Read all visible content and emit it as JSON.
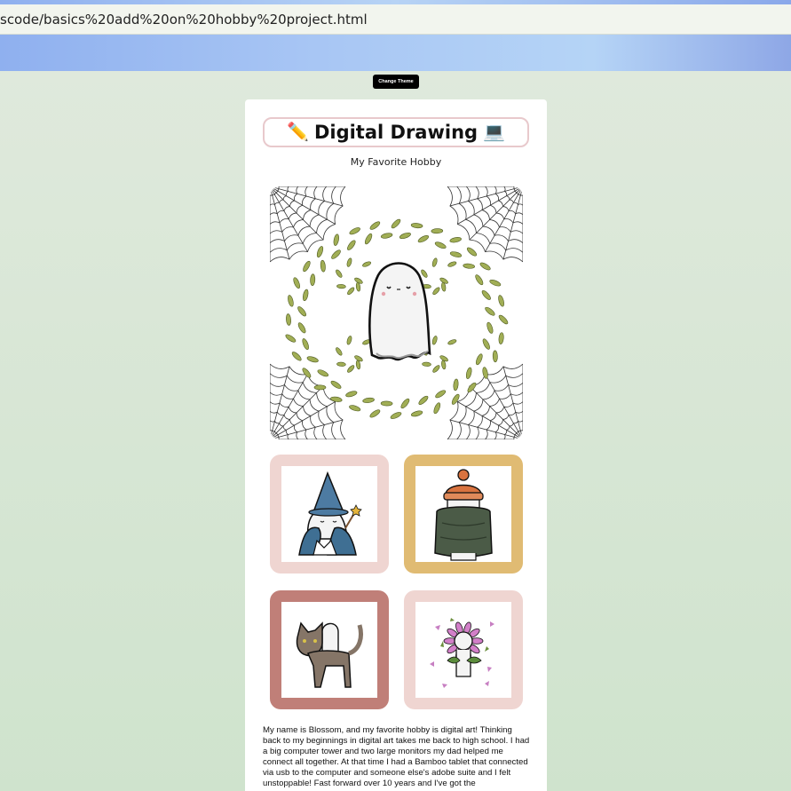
{
  "browser": {
    "url": "scode/basics%20add%20on%20hobby%20project.html"
  },
  "toolbar": {
    "change_theme_label": "Change Theme"
  },
  "page": {
    "title_emoji_left": "✏️",
    "title": "Digital Drawing",
    "title_emoji_right": "💻",
    "subtitle": "My Favorite Hobby",
    "bio": "My name is Blossom, and my favorite hobby is digital art! Thinking back to my beginnings in digital art takes me back to high school. I had a big computer tower and two large monitors my dad helped me connect all together. At that time I had a Bamboo tablet that connected via usb to the computer and someone else's adobe suite and I felt unstoppable! Fast forward over 10 years and I've got the"
  },
  "gallery": {
    "frame_colors": [
      "#efd5d1",
      "#e0bb73",
      "#c07f78",
      "#efd5d1"
    ],
    "images": [
      "wizard-ghost",
      "beanie-ghost",
      "cat-ghost",
      "flower-ghost"
    ]
  },
  "colors": {
    "title_border": "#e8c9cc",
    "leaf": "#9aa84e",
    "beanie": "#d9733f",
    "wizard_blue": "#3f6f93",
    "coat_green": "#4b5b47"
  }
}
